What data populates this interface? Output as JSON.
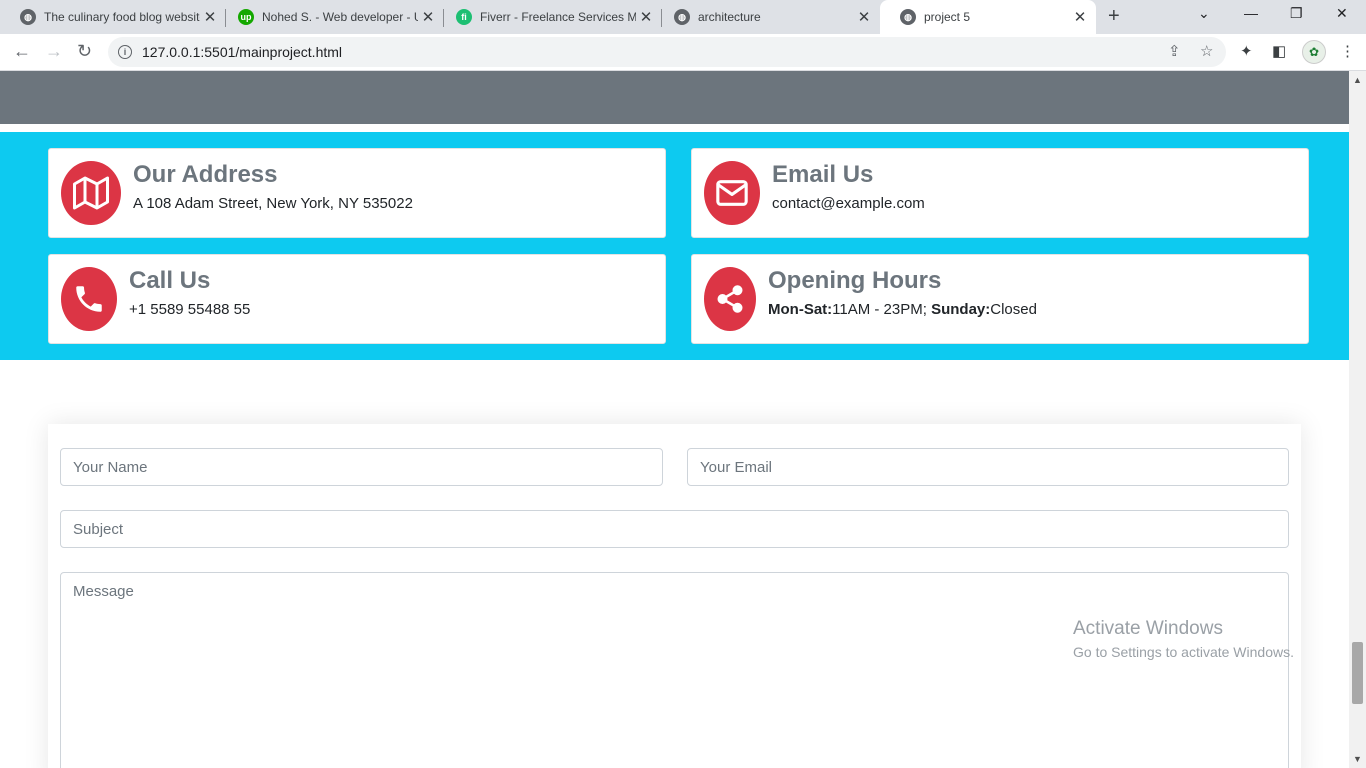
{
  "browser": {
    "tabs": [
      {
        "title": "The culinary food blog website",
        "favicon": "globe-icon"
      },
      {
        "title": "Nohed S. - Web developer - Upwork",
        "favicon": "upwork-icon"
      },
      {
        "title": "Fiverr - Freelance Services Marketplace",
        "favicon": "fiverr-icon"
      },
      {
        "title": "architecture",
        "favicon": "globe-icon"
      },
      {
        "title": "project 5",
        "favicon": "globe-icon",
        "active": true
      }
    ],
    "url": "127.0.0.1:5501/mainproject.html"
  },
  "info_cards": [
    {
      "title": "Our Address",
      "text": "A 108 Adam Street, New York, NY 535022",
      "icon": "map-icon"
    },
    {
      "title": "Email Us",
      "text": "contact@example.com",
      "icon": "envelope-icon"
    },
    {
      "title": "Call Us",
      "text": "+1 5589 55488 55",
      "icon": "phone-icon"
    },
    {
      "title": "Opening Hours",
      "label1": "Mon-Sat:",
      "value1": "11AM - 23PM; ",
      "label2": "Sunday:",
      "value2": "Closed",
      "icon": "share-icon"
    }
  ],
  "form": {
    "name_placeholder": "Your Name",
    "email_placeholder": "Your Email",
    "subject_placeholder": "Subject",
    "message_placeholder": "Message"
  },
  "watermark": {
    "line1": "Activate Windows",
    "line2": "Go to Settings to activate Windows."
  },
  "colors": {
    "accent_red": "#dc3545",
    "cyan_band": "#0dcaf0",
    "gray_band": "#6c757d"
  }
}
